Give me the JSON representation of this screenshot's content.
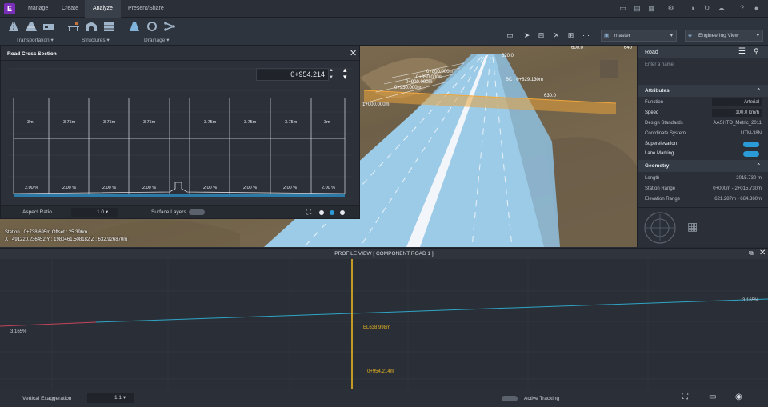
{
  "app": {
    "logo_letter": "E",
    "accent": "#7a2fb8"
  },
  "menu": {
    "tabs": [
      "Manage",
      "Create",
      "Analyze",
      "Present/Share"
    ],
    "active": "Analyze"
  },
  "ribbon": {
    "groups": [
      "Transportation",
      "Structures",
      "Drainage"
    ],
    "proposal_dropdown": "master",
    "view_dropdown": "Engineering View"
  },
  "cross_section": {
    "title": "Road Cross Section",
    "station_value": "0+954.214",
    "lane_widths": [
      "3m",
      "3.75m",
      "3.75m",
      "3.75m",
      "3.75m",
      "3.75m",
      "3.75m",
      "3m"
    ],
    "slopes": [
      "2.00 %",
      "2.00 %",
      "2.00 %",
      "2.00 %",
      "2.00 %",
      "2.00 %",
      "2.00 %",
      "2.00 %"
    ],
    "aspect_ratio_label": "Aspect Ratio",
    "aspect_ratio_value": "1.0",
    "surface_layers_label": "Surface Layers"
  },
  "viewport": {
    "labels": [
      {
        "text": "620.0",
        "cls": "m1"
      },
      {
        "text": "600.0",
        "cls": "m2"
      },
      {
        "text": "640",
        "cls": "m3"
      },
      {
        "text": "0+800.000m",
        "cls": "m4"
      },
      {
        "text": "0+850.000m",
        "cls": "m5"
      },
      {
        "text": "0+900.000m",
        "cls": "m6"
      },
      {
        "text": "0+950.000m",
        "cls": "m7"
      },
      {
        "text": "1+000.000m",
        "cls": "m8"
      },
      {
        "text": "BC : 0+829.130m",
        "cls": "m9"
      },
      {
        "text": "630.0",
        "cls": "m10"
      }
    ],
    "status_line1": "Station : 0+738.695m Offset : 25.396m",
    "status_line2": "X : 491220.236452 Y : 1980461.508182 Z : 632.926870m"
  },
  "right_panel": {
    "title": "Road",
    "name_placeholder": "Enter a name",
    "attributes_title": "Attributes",
    "attributes": [
      {
        "label": "Function",
        "value": "Arterial"
      },
      {
        "label": "Speed",
        "value": "100.0  km/h"
      },
      {
        "label": "Design Standards",
        "value": "AASHTO_Metric_2011"
      },
      {
        "label": "Coordinate System",
        "value": "UTM-38N"
      },
      {
        "label": "Superelevation",
        "value": "ON"
      },
      {
        "label": "Lane Marking",
        "value": "ON"
      }
    ],
    "geometry_title": "Geometry",
    "geometry": [
      {
        "label": "Length",
        "value": "2015.730  m"
      },
      {
        "label": "Station Range",
        "value": "0+000m - 2+015.730m"
      },
      {
        "label": "Elevation Range",
        "value": "621.287m - 664.360m"
      }
    ]
  },
  "profile": {
    "title": "PROFILE VIEW [ COMPONENT ROAD 1 ]",
    "grade_left": "3.165%",
    "grade_right": "3.165%",
    "elevation_label": "EL638.998m",
    "station_label": "0+954.214m",
    "vertical_exaggeration_label": "Vertical Exaggeration",
    "vertical_exaggeration_value": "1:1",
    "active_tracking_label": "Active Tracking"
  }
}
